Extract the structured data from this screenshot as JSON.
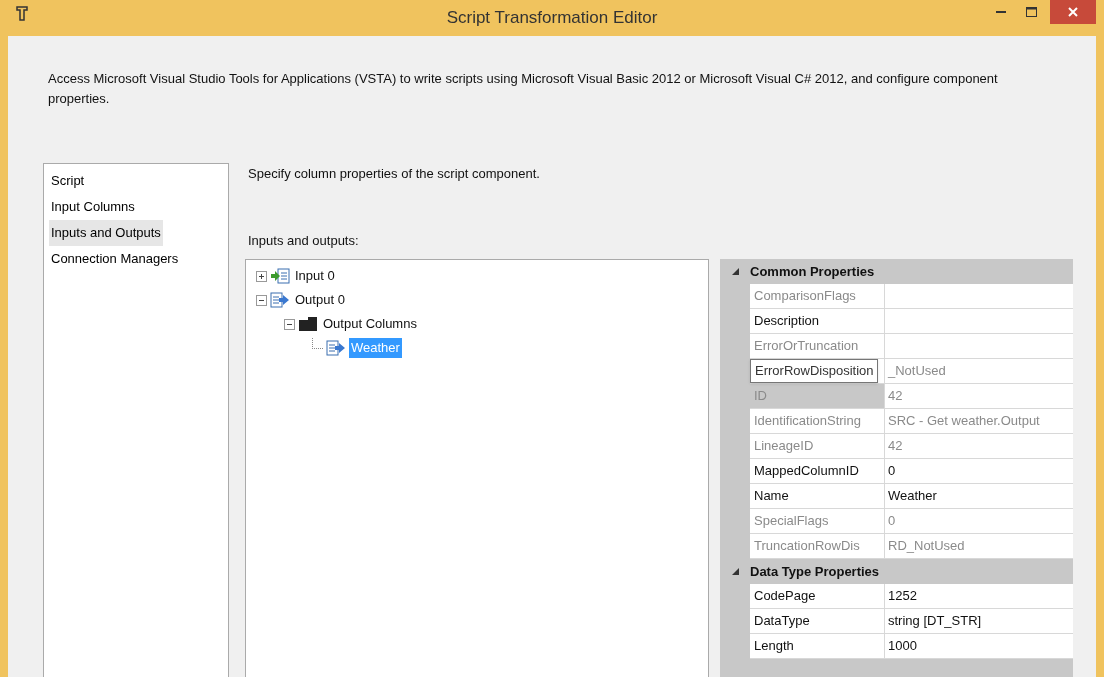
{
  "window": {
    "title": "Script Transformation Editor"
  },
  "description": "Access Microsoft Visual Studio Tools for Applications (VSTA) to write scripts using Microsoft Visual Basic 2012 or Microsoft Visual C# 2012, and configure component properties.",
  "sidebar": {
    "items": [
      {
        "label": "Script",
        "selected": false
      },
      {
        "label": "Input Columns",
        "selected": false
      },
      {
        "label": "Inputs and Outputs",
        "selected": true
      },
      {
        "label": "Connection Managers",
        "selected": false
      }
    ]
  },
  "page_heading": "Specify column properties of the script component.",
  "tree_label": "Inputs and outputs:",
  "tree": [
    {
      "label": "Input 0",
      "kind": "input",
      "expanded": false,
      "selected": false
    },
    {
      "label": "Output 0",
      "kind": "output",
      "expanded": true,
      "selected": false,
      "children": [
        {
          "label": "Output Columns",
          "kind": "folder",
          "expanded": true,
          "selected": false,
          "children": [
            {
              "label": "Weather",
              "kind": "column",
              "selected": true
            }
          ]
        }
      ]
    }
  ],
  "properties": [
    {
      "category": "Common Properties",
      "expanded": true,
      "rows": [
        {
          "name": "ComparisonFlags",
          "value": "",
          "editable": false,
          "selected": false
        },
        {
          "name": "Description",
          "value": "",
          "editable": true,
          "selected": false
        },
        {
          "name": "ErrorOrTruncation",
          "value": "",
          "editable": false,
          "selected": false
        },
        {
          "name": "",
          "value": "_NotUsed",
          "editable": false,
          "selected": false
        },
        {
          "name": "ID",
          "value": "42",
          "editable": false,
          "selected": true
        },
        {
          "name": "IdentificationString",
          "value": "SRC - Get weather.Output",
          "editable": false,
          "selected": false
        },
        {
          "name": "LineageID",
          "value": "42",
          "editable": false,
          "selected": false
        },
        {
          "name": "MappedColumnID",
          "value": "0",
          "editable": true,
          "selected": false
        },
        {
          "name": "Name",
          "value": "Weather",
          "editable": true,
          "selected": false
        },
        {
          "name": "SpecialFlags",
          "value": "0",
          "editable": false,
          "selected": false
        },
        {
          "name": "TruncationRowDis",
          "value": "RD_NotUsed",
          "editable": false,
          "selected": false
        }
      ]
    },
    {
      "category": "Data Type Properties",
      "expanded": true,
      "rows": [
        {
          "name": "CodePage",
          "value": "1252",
          "editable": true,
          "selected": false
        },
        {
          "name": "DataType",
          "value": "string [DT_STR]",
          "editable": true,
          "selected": false
        },
        {
          "name": "Length",
          "value": "1000",
          "editable": true,
          "selected": false
        }
      ]
    }
  ],
  "tooltip": "ErrorRowDisposition"
}
